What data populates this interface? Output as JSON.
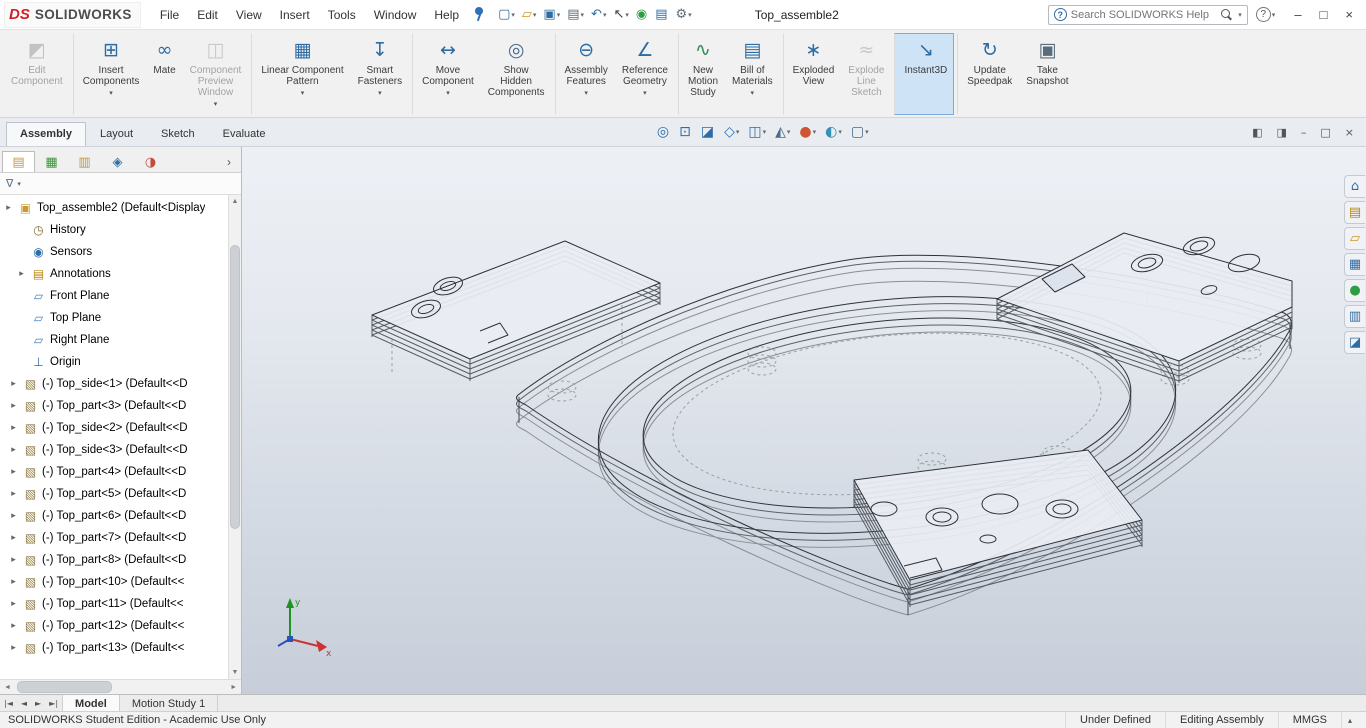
{
  "colors": {
    "brand_red": "#d1202a",
    "accent": "#2e6da4",
    "active_button_bg": "#cfe3f6",
    "active_button_border": "#7aabdd"
  },
  "titlebar": {
    "logo_ds": "DS",
    "brand": "SOLIDWORKS",
    "menus": [
      "File",
      "Edit",
      "View",
      "Insert",
      "Tools",
      "Window",
      "Help"
    ],
    "pin_icon": "pushpin",
    "quick_access": [
      {
        "name": "new-document-button",
        "glyph": "▢",
        "color": "#2e6da4",
        "caret": "▾"
      },
      {
        "name": "open-button",
        "glyph": "▱",
        "color": "#c9952c",
        "caret": "▾"
      },
      {
        "name": "save-button",
        "glyph": "▣",
        "color": "#2e6da4",
        "caret": "▾"
      },
      {
        "name": "print-button",
        "glyph": "▤",
        "color": "#5a6b7a",
        "caret": "▾"
      },
      {
        "name": "undo-button",
        "glyph": "↶",
        "color": "#2e6da4",
        "caret": "▾"
      },
      {
        "name": "select-button",
        "glyph": "↖",
        "color": "#3b3f46",
        "caret": "▾"
      },
      {
        "name": "options-toggle-button",
        "glyph": "◉",
        "color": "#2e9e44",
        "caret": ""
      },
      {
        "name": "task-list-button",
        "glyph": "▤",
        "color": "#2e6da4",
        "caret": ""
      },
      {
        "name": "settings-button",
        "glyph": "⚙",
        "color": "#5a6b7a",
        "caret": "▾"
      }
    ],
    "document_title": "Top_assemble2",
    "search": {
      "badge": "?",
      "placeholder": "Search SOLIDWORKS Help",
      "caret": "▾"
    },
    "help_label": "?",
    "help_caret": "▾",
    "window_buttons": {
      "minimize": "–",
      "maximize": "□",
      "close": "×"
    }
  },
  "ribbon": {
    "buttons": [
      {
        "name": "edit-component-button",
        "lines": [
          "Edit",
          "Component",
          ""
        ],
        "glyph": "◩",
        "color": "#8a8a8a",
        "caret": "",
        "state": "disabled",
        "group": ""
      },
      {
        "name": "insert-components-button",
        "lines": [
          "Insert",
          "Components",
          ""
        ],
        "glyph": "⊞",
        "color": "#2e6da4",
        "caret": "▾",
        "state": "",
        "group": "gsep"
      },
      {
        "name": "mate-button",
        "lines": [
          "Mate",
          "",
          ""
        ],
        "glyph": "∞",
        "color": "#2e6da4",
        "caret": "",
        "state": "",
        "group": ""
      },
      {
        "name": "component-preview-window-button",
        "lines": [
          "Component",
          "Preview",
          "Window"
        ],
        "glyph": "◫",
        "color": "#9a9a9a",
        "caret": "▾",
        "state": "disabled",
        "group": ""
      },
      {
        "name": "linear-component-pattern-button",
        "lines": [
          "Linear Component",
          "Pattern",
          ""
        ],
        "glyph": "▦",
        "color": "#2e6da4",
        "caret": "▾",
        "state": "",
        "group": "gsep"
      },
      {
        "name": "smart-fasteners-button",
        "lines": [
          "Smart",
          "Fasteners",
          ""
        ],
        "glyph": "↧",
        "color": "#2e6da4",
        "caret": "▾",
        "state": "",
        "group": ""
      },
      {
        "name": "move-component-button",
        "lines": [
          "Move",
          "Component",
          ""
        ],
        "glyph": "↔",
        "color": "#2e6da4",
        "caret": "▾",
        "state": "",
        "group": "gsep"
      },
      {
        "name": "show-hidden-components-button",
        "lines": [
          "Show",
          "Hidden",
          "Components"
        ],
        "glyph": "◎",
        "color": "#4a6b8a",
        "caret": "",
        "state": "",
        "group": ""
      },
      {
        "name": "assembly-features-button",
        "lines": [
          "Assembly",
          "Features",
          ""
        ],
        "glyph": "⊖",
        "color": "#2e6da4",
        "caret": "▾",
        "state": "",
        "group": "gsep"
      },
      {
        "name": "reference-geometry-button",
        "lines": [
          "Reference",
          "Geometry",
          ""
        ],
        "glyph": "∠",
        "color": "#2e6da4",
        "caret": "▾",
        "state": "",
        "group": ""
      },
      {
        "name": "new-motion-study-button",
        "lines": [
          "New",
          "Motion",
          "Study"
        ],
        "glyph": "∿",
        "color": "#2e8b57",
        "caret": "",
        "state": "",
        "group": "gsep"
      },
      {
        "name": "bill-of-materials-button",
        "lines": [
          "Bill of",
          "Materials",
          ""
        ],
        "glyph": "▤",
        "color": "#2e6da4",
        "caret": "▾",
        "state": "",
        "group": ""
      },
      {
        "name": "exploded-view-button",
        "lines": [
          "Exploded",
          "View",
          ""
        ],
        "glyph": "∗",
        "color": "#2e6da4",
        "caret": "",
        "state": "",
        "group": "gsep"
      },
      {
        "name": "explode-line-sketch-button",
        "lines": [
          "Explode",
          "Line",
          "Sketch"
        ],
        "glyph": "≈",
        "color": "#9a9a9a",
        "caret": "",
        "state": "disabled",
        "group": ""
      },
      {
        "name": "instant3d-button",
        "lines": [
          "Instant3D",
          "",
          ""
        ],
        "glyph": "↘",
        "color": "#2e6da4",
        "caret": "",
        "state": "active",
        "group": "gsep"
      },
      {
        "name": "update-speedpak-button",
        "lines": [
          "Update",
          "Speedpak",
          ""
        ],
        "glyph": "↻",
        "color": "#2e6da4",
        "caret": "",
        "state": "",
        "group": "gsep"
      },
      {
        "name": "take-snapshot-button",
        "lines": [
          "Take",
          "Snapshot",
          ""
        ],
        "glyph": "▣",
        "color": "#5a6b7a",
        "caret": "",
        "state": "",
        "group": ""
      }
    ],
    "tabs": [
      {
        "name": "tab-assembly",
        "label": "Assembly",
        "state": "active"
      },
      {
        "name": "tab-layout",
        "label": "Layout",
        "state": ""
      },
      {
        "name": "tab-sketch",
        "label": "Sketch",
        "state": ""
      },
      {
        "name": "tab-evaluate",
        "label": "Evaluate",
        "state": ""
      }
    ]
  },
  "viewport": {
    "headsup": [
      {
        "name": "zoom-to-fit-icon",
        "glyph": "◎",
        "color": "#2e6da4",
        "caret": ""
      },
      {
        "name": "zoom-to-area-icon",
        "glyph": "⊡",
        "color": "#2e6da4",
        "caret": ""
      },
      {
        "name": "section-view-icon",
        "glyph": "◪",
        "color": "#2e6da4",
        "caret": ""
      },
      {
        "name": "view-orientation-icon",
        "glyph": "◇",
        "color": "#2e6da4",
        "caret": "▾"
      },
      {
        "name": "display-style-icon",
        "glyph": "◫",
        "color": "#2e6da4",
        "caret": "▾"
      },
      {
        "name": "hide-show-items-icon",
        "glyph": "◭",
        "color": "#4a6b8a",
        "caret": "▾"
      },
      {
        "name": "edit-appearance-icon",
        "glyph": "●",
        "color": "#cc5533",
        "caret": "▾"
      },
      {
        "name": "apply-scene-icon",
        "glyph": "◐",
        "color": "#3a8fb5",
        "caret": "▾"
      },
      {
        "name": "view-settings-icon",
        "glyph": "▢",
        "color": "#4a6b8a",
        "caret": "▾"
      }
    ],
    "window_controls": [
      {
        "name": "pane-previous-button",
        "glyph": "◧"
      },
      {
        "name": "pane-next-button",
        "glyph": "◨"
      },
      {
        "name": "document-minimize-button",
        "glyph": "–"
      },
      {
        "name": "document-restore-button",
        "glyph": "□"
      },
      {
        "name": "document-close-button",
        "glyph": "×"
      }
    ]
  },
  "panel": {
    "tabs": [
      {
        "name": "featuremanager-tab",
        "glyph": "▤",
        "color": "#c49a3f",
        "state": "selected"
      },
      {
        "name": "propertymanager-tab",
        "glyph": "▦",
        "color": "#3f8f3f",
        "state": ""
      },
      {
        "name": "configurationmanager-tab",
        "glyph": "▥",
        "color": "#b9983f",
        "state": ""
      },
      {
        "name": "dimxpertmanager-tab",
        "glyph": "◈",
        "color": "#2e6da4",
        "state": ""
      },
      {
        "name": "displaymanager-tab",
        "glyph": "◑",
        "color": "#c44a3a",
        "state": ""
      }
    ],
    "chevron": "›",
    "filter_glyph": "∇",
    "filter_caret": "▾",
    "tree": [
      {
        "pad": "3px",
        "arrow": "▸",
        "glyph": "▣",
        "color": "#c99a2e",
        "label": "Top_assemble2 (Default<Display"
      },
      {
        "pad": "16px",
        "arrow": "",
        "glyph": "◷",
        "color": "#8a6d3b",
        "label": "History"
      },
      {
        "pad": "16px",
        "arrow": "",
        "glyph": "◉",
        "color": "#2e6da4",
        "label": "Sensors"
      },
      {
        "pad": "16px",
        "arrow": "▸",
        "glyph": "▤",
        "color": "#b8860b",
        "label": "Annotations"
      },
      {
        "pad": "16px",
        "arrow": "",
        "glyph": "▱",
        "color": "#4a7ebb",
        "label": "Front Plane"
      },
      {
        "pad": "16px",
        "arrow": "",
        "glyph": "▱",
        "color": "#4a7ebb",
        "label": "Top Plane"
      },
      {
        "pad": "16px",
        "arrow": "",
        "glyph": "▱",
        "color": "#4a7ebb",
        "label": "Right Plane"
      },
      {
        "pad": "16px",
        "arrow": "",
        "glyph": "⊥",
        "color": "#2e6da4",
        "label": "Origin"
      },
      {
        "pad": "8px",
        "arrow": "▸",
        "glyph": "▧",
        "color": "#8f7a45",
        "label": "(-) Top_side<1> (Default<<D"
      },
      {
        "pad": "8px",
        "arrow": "▸",
        "glyph": "▧",
        "color": "#8f7a45",
        "label": "(-) Top_part<3> (Default<<D"
      },
      {
        "pad": "8px",
        "arrow": "▸",
        "glyph": "▧",
        "color": "#8f7a45",
        "label": "(-) Top_side<2> (Default<<D"
      },
      {
        "pad": "8px",
        "arrow": "▸",
        "glyph": "▧",
        "color": "#8f7a45",
        "label": "(-) Top_side<3> (Default<<D"
      },
      {
        "pad": "8px",
        "arrow": "▸",
        "glyph": "▧",
        "color": "#8f7a45",
        "label": "(-) Top_part<4> (Default<<D"
      },
      {
        "pad": "8px",
        "arrow": "▸",
        "glyph": "▧",
        "color": "#8f7a45",
        "label": "(-) Top_part<5> (Default<<D"
      },
      {
        "pad": "8px",
        "arrow": "▸",
        "glyph": "▧",
        "color": "#8f7a45",
        "label": "(-) Top_part<6> (Default<<D"
      },
      {
        "pad": "8px",
        "arrow": "▸",
        "glyph": "▧",
        "color": "#8f7a45",
        "label": "(-) Top_part<7> (Default<<D"
      },
      {
        "pad": "8px",
        "arrow": "▸",
        "glyph": "▧",
        "color": "#8f7a45",
        "label": "(-) Top_part<8> (Default<<D"
      },
      {
        "pad": "8px",
        "arrow": "▸",
        "glyph": "▧",
        "color": "#8f7a45",
        "label": "(-) Top_part<10> (Default<<"
      },
      {
        "pad": "8px",
        "arrow": "▸",
        "glyph": "▧",
        "color": "#8f7a45",
        "label": "(-) Top_part<11> (Default<<"
      },
      {
        "pad": "8px",
        "arrow": "▸",
        "glyph": "▧",
        "color": "#8f7a45",
        "label": "(-) Top_part<12> (Default<<"
      },
      {
        "pad": "8px",
        "arrow": "▸",
        "glyph": "▧",
        "color": "#8f7a45",
        "label": "(-) Top_part<13> (Default<<"
      }
    ]
  },
  "taskpane": [
    {
      "name": "solidworks-resources-icon",
      "glyph": "⌂",
      "color": "#2e6da4"
    },
    {
      "name": "design-library-icon",
      "glyph": "▤",
      "color": "#b8860b"
    },
    {
      "name": "file-explorer-icon",
      "glyph": "▱",
      "color": "#c9952c"
    },
    {
      "name": "view-palette-icon",
      "glyph": "▦",
      "color": "#2e6da4"
    },
    {
      "name": "appearances-scenes-icon",
      "glyph": "●",
      "color": "#2e9e44"
    },
    {
      "name": "custom-properties-icon",
      "glyph": "▥",
      "color": "#2e6da4"
    },
    {
      "name": "solidworks-forum-icon",
      "glyph": "◪",
      "color": "#2e6da4"
    }
  ],
  "bottom": {
    "nav": [
      "|◄",
      "◄",
      "►",
      "►|"
    ],
    "tabs": [
      {
        "name": "tab-model",
        "label": "Model",
        "state": "active"
      },
      {
        "name": "tab-motion-study-1",
        "label": "Motion Study 1",
        "state": ""
      }
    ]
  },
  "statusbar": {
    "left": "SOLIDWORKS Student Edition - Academic Use Only",
    "cells": [
      {
        "label": "Under Defined"
      },
      {
        "label": "Editing Assembly"
      },
      {
        "label": "MMGS"
      }
    ],
    "caret": "▴"
  }
}
